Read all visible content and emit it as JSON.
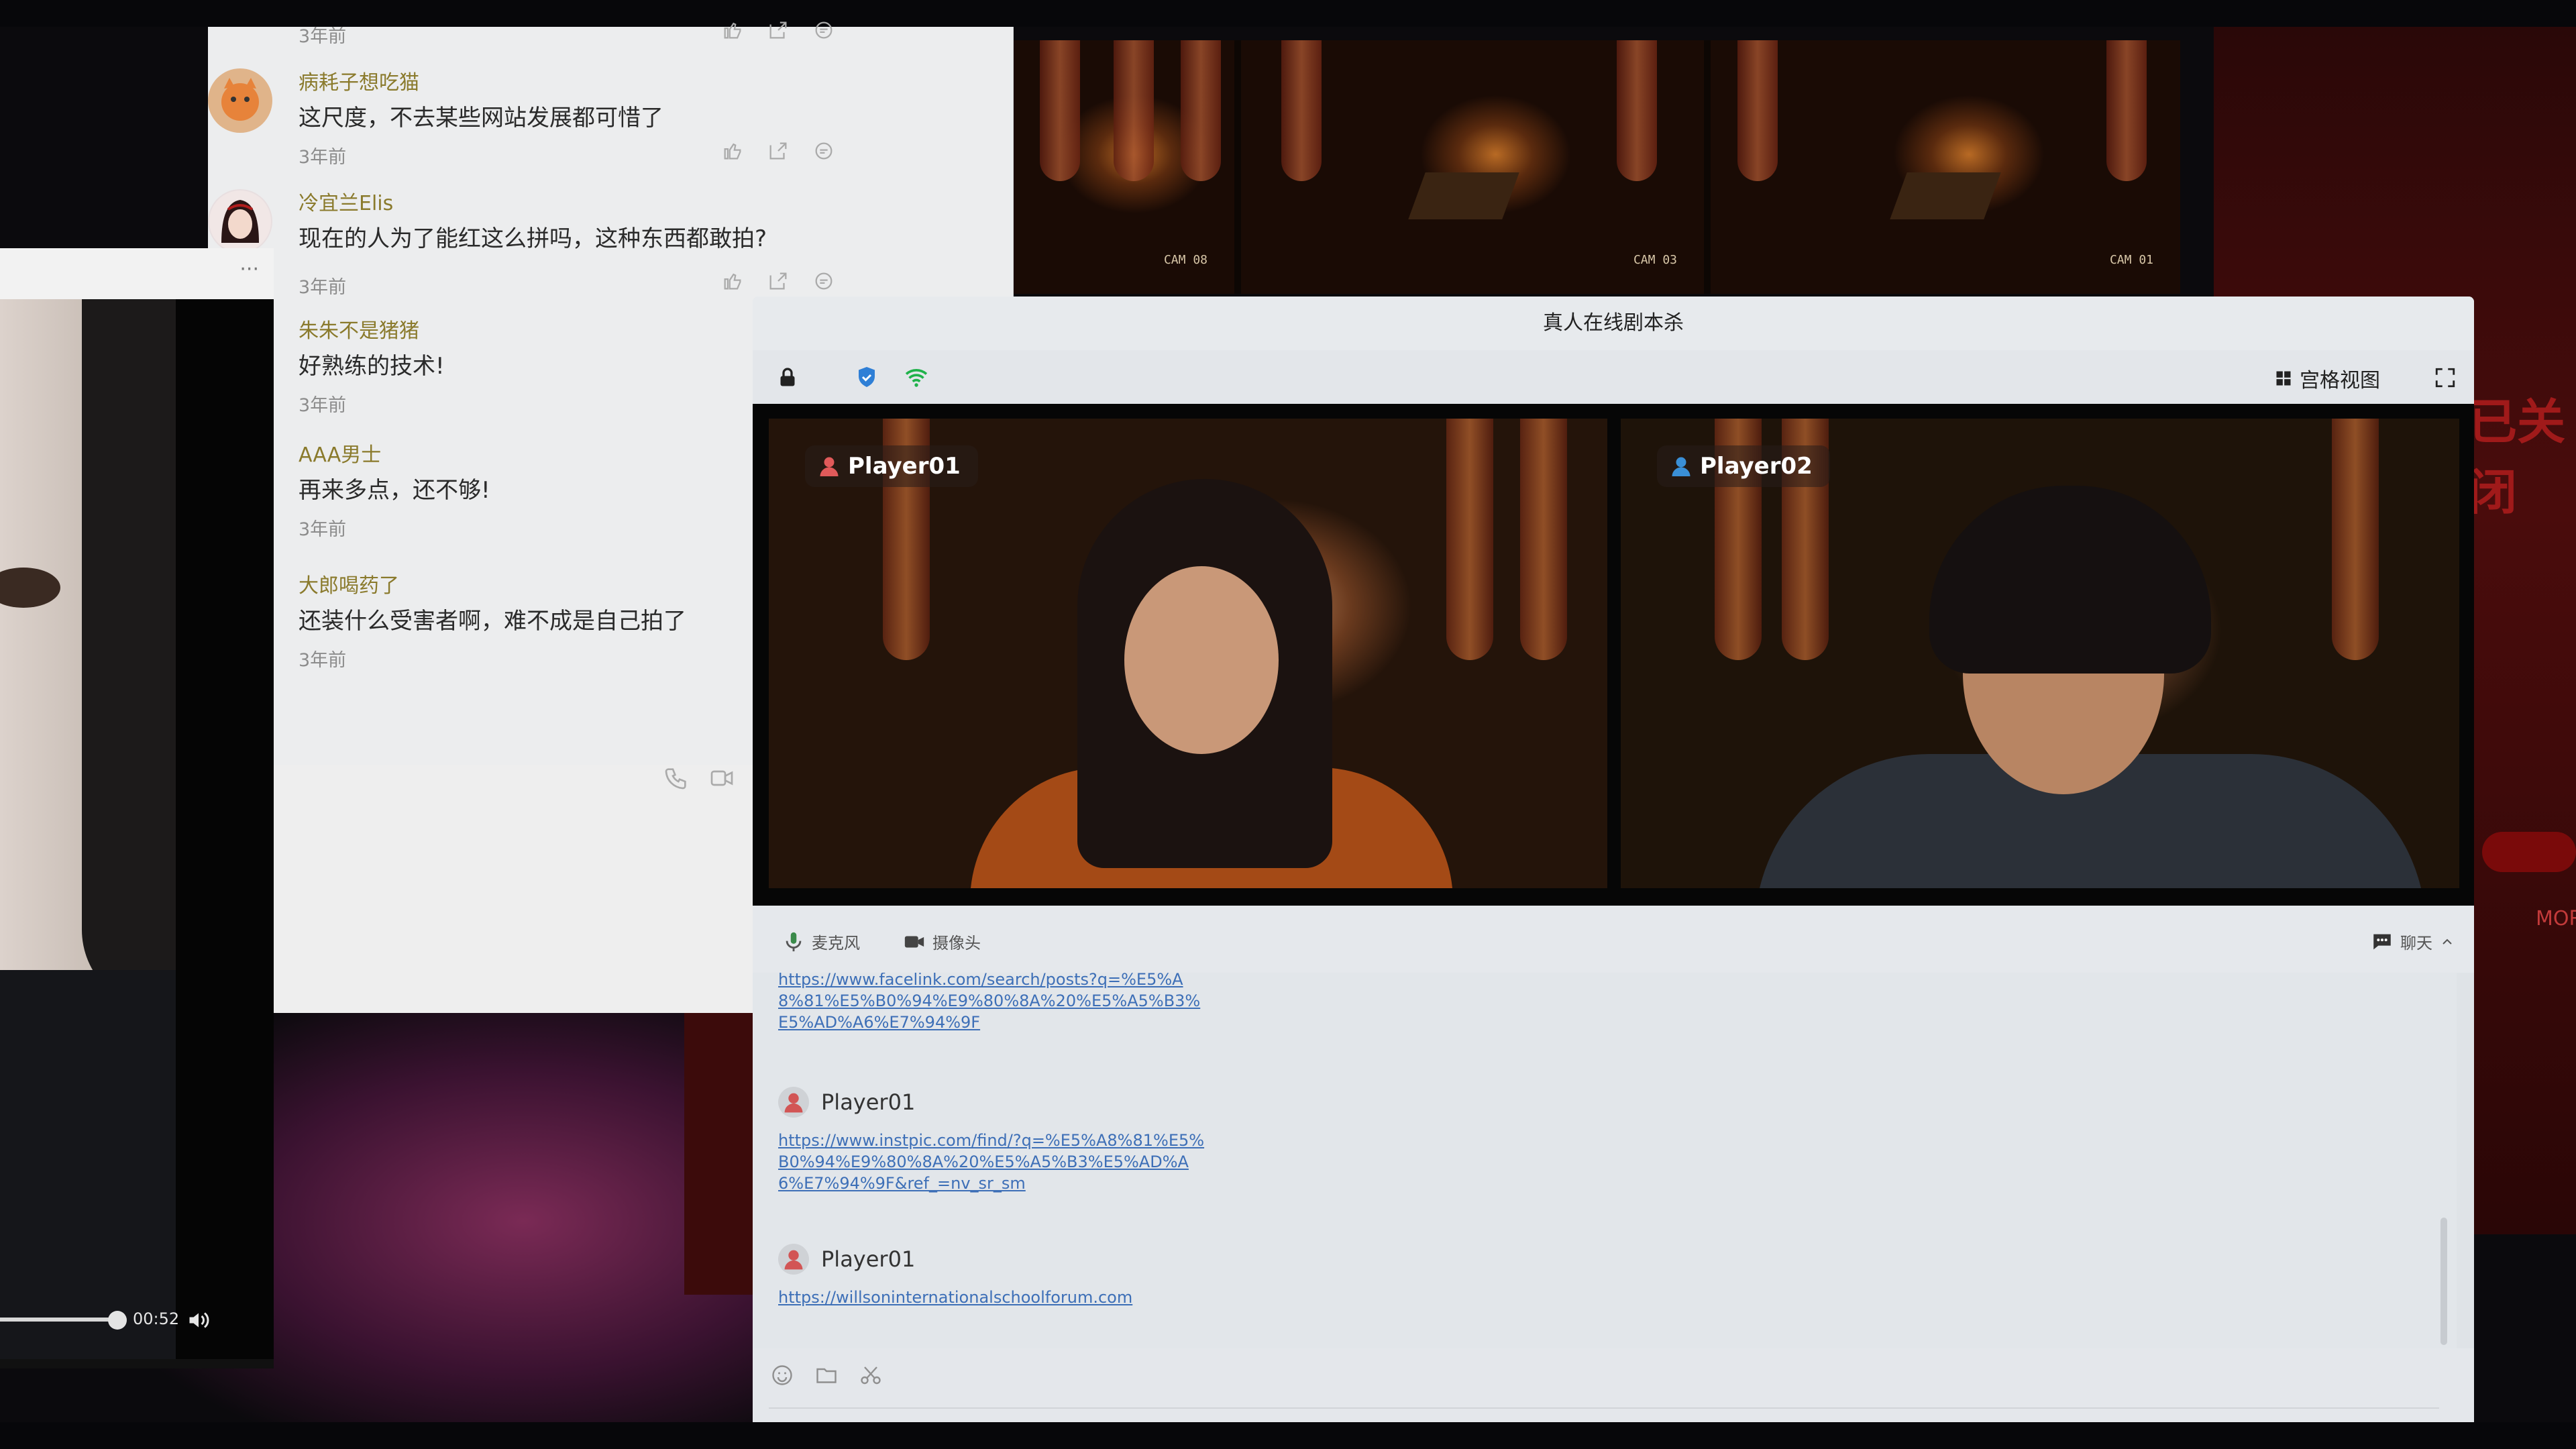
{
  "cctv": {
    "cams": [
      "CAM 08",
      "CAM 03",
      "CAM 01"
    ]
  },
  "comments": [
    {
      "username": "",
      "text": "",
      "time": "3年前"
    },
    {
      "username": "病耗子想吃猫",
      "text": "这尺度，不去某些网站发展都可惜了",
      "time": "3年前"
    },
    {
      "username": "冷宜兰Elis",
      "text": "现在的人为了能红这么拼吗，这种东西都敢拍?",
      "time": "3年前"
    },
    {
      "username": "朱朱不是猪猪",
      "text": "好熟练的技术!",
      "time": "3年前"
    },
    {
      "username": "AAA男士",
      "text": "再来多点，还不够!",
      "time": "3年前"
    },
    {
      "username": "大郎喝药了",
      "text": "还装什么受害者啊，难不成是自己拍了",
      "time": "3年前"
    }
  ],
  "left_video": {
    "menu": "···",
    "time": "00:52",
    "progress": 0.43
  },
  "main_window": {
    "title": "真人在线剧本杀",
    "grid_view_label": "宫格视图",
    "players": [
      {
        "name": "Player01",
        "avatar_color": "#e05a5a"
      },
      {
        "name": "Player02",
        "avatar_color": "#3a8fd6"
      }
    ],
    "controls": {
      "mic_label": "麦克风",
      "camera_label": "摄像头",
      "chat_label": "聊天"
    },
    "chat_messages": [
      {
        "sender": "",
        "link": "https://www.facelink.com/search/posts?q=%E5%A8%81%E5%B0%94%E9%80%8A%20%E5%A5%B3%E5%AD%A6%E7%94%9F"
      },
      {
        "sender": "Player01",
        "link": "https://www.instpic.com/find/?q=%E5%A8%81%E5%B0%94%E9%80%8A%20%E5%A5%B3%E5%AD%A6%E7%94%9F&ref_=nv_sr_sm"
      },
      {
        "sender": "Player01",
        "link": "https://willsoninternationalschoolforum.com"
      }
    ]
  },
  "background": {
    "more_label": "MOR",
    "red_text": "已关闭"
  },
  "colors": {
    "accent_blue": "#2f7fd6",
    "wifi_green": "#1fb24a",
    "link_blue": "#3d6fb7",
    "username_gold": "#8a7a2c"
  }
}
